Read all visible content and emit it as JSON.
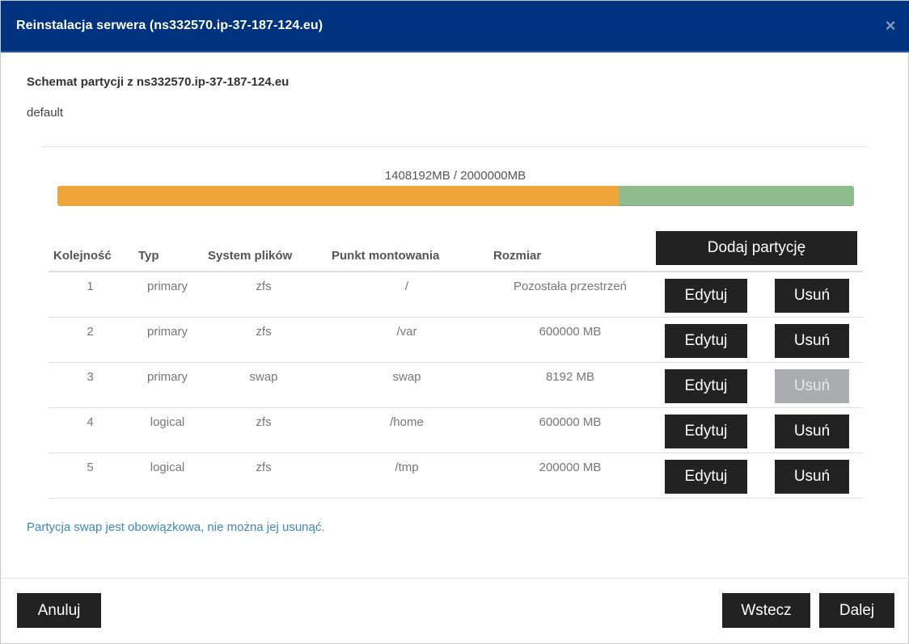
{
  "dialog": {
    "title": "Reinstalacja serwera (ns332570.ip-37-187-124.eu)",
    "close_glyph": "×"
  },
  "scheme": {
    "title": "Schemat partycji z ns332570.ip-37-187-124.eu",
    "name": "default"
  },
  "usage": {
    "text": "1408192MB / 2000000MB",
    "used_mb": 1408192,
    "total_mb": 2000000,
    "used_fraction": 0.7041,
    "colors": {
      "used": "#f0a53b",
      "free": "#8fbc8f"
    }
  },
  "table": {
    "headers": {
      "order": "Kolejność",
      "type": "Typ",
      "filesystem": "System plików",
      "mountpoint": "Punkt montowania",
      "size": "Rozmiar"
    },
    "add_label": "Dodaj partycję",
    "edit_label": "Edytuj",
    "delete_label": "Usuń",
    "rows": [
      {
        "order": "1",
        "type": "primary",
        "fs": "zfs",
        "mount": "/",
        "size": "Pozostała przestrzeń",
        "delete_disabled": false
      },
      {
        "order": "2",
        "type": "primary",
        "fs": "zfs",
        "mount": "/var",
        "size": "600000 MB",
        "delete_disabled": false
      },
      {
        "order": "3",
        "type": "primary",
        "fs": "swap",
        "mount": "swap",
        "size": "8192 MB",
        "delete_disabled": true
      },
      {
        "order": "4",
        "type": "logical",
        "fs": "zfs",
        "mount": "/home",
        "size": "600000 MB",
        "delete_disabled": false
      },
      {
        "order": "5",
        "type": "logical",
        "fs": "zfs",
        "mount": "/tmp",
        "size": "200000 MB",
        "delete_disabled": false
      }
    ]
  },
  "info_text": "Partycja swap jest obowiązkowa, nie można jej usunąć.",
  "footer": {
    "cancel": "Anuluj",
    "back": "Wstecz",
    "next": "Dalej"
  }
}
